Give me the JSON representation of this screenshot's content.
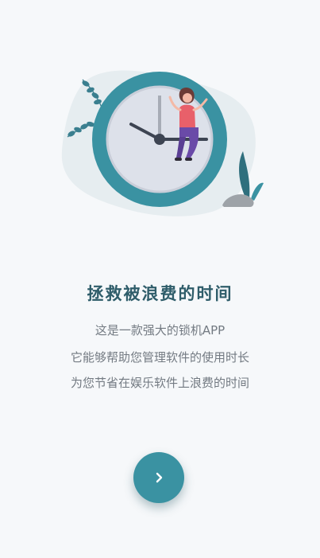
{
  "onboarding": {
    "title": "拯救被浪费的时间",
    "description_lines": [
      "这是一款强大的锁机APP",
      "它能够帮助您管理软件的使用时长",
      "为您节省在娱乐软件上浪费的时间"
    ],
    "next_icon": "chevron-right-icon",
    "illustration": "clock-with-woman-sitting-illustration"
  },
  "colors": {
    "background": "#f6f8fa",
    "accent": "#3a92a2",
    "title": "#2f5d6a",
    "body_text": "#737a82"
  }
}
